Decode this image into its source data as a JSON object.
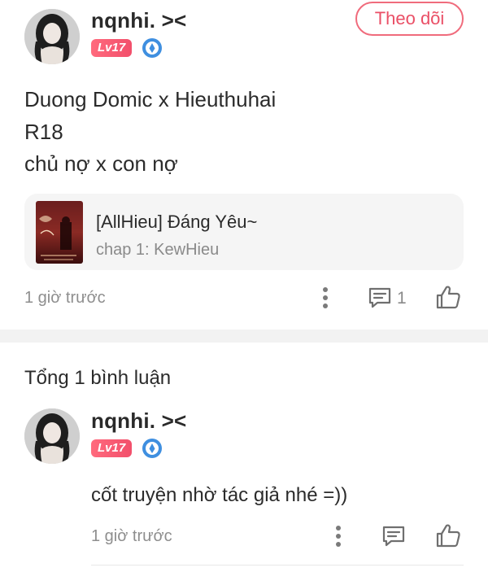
{
  "post": {
    "author": {
      "name": "nqnhi. ><",
      "level": "Lv17",
      "verified_icon": "verified-badge-icon"
    },
    "follow_label": "Theo dõi",
    "content_lines": [
      "Duong Domic x Hieuthuhai",
      "R18",
      "chủ nợ x con nợ"
    ],
    "story": {
      "title": "[AllHieu] Đáng Yêu~",
      "chapter": "chap 1: KewHieu",
      "cover_icon": "story-cover-image"
    },
    "time": "1 giờ trước",
    "comment_count": "1",
    "icons": {
      "more": "more-vertical-icon",
      "comment": "comment-icon",
      "like": "thumbs-up-icon"
    }
  },
  "comments_section": {
    "total_label": "Tổng 1 bình luận",
    "comments": [
      {
        "author": {
          "name": "nqnhi. ><",
          "level": "Lv17"
        },
        "text": "cốt truyện nhờ tác giả nhé =))",
        "time": "1 giờ trước"
      }
    ]
  },
  "colors": {
    "accent": "#ea4f66",
    "level_badge": "#f24f6b",
    "verify_blue": "#3f8fe0",
    "muted_text": "#8e8e8e",
    "card_bg": "#f5f5f5"
  }
}
